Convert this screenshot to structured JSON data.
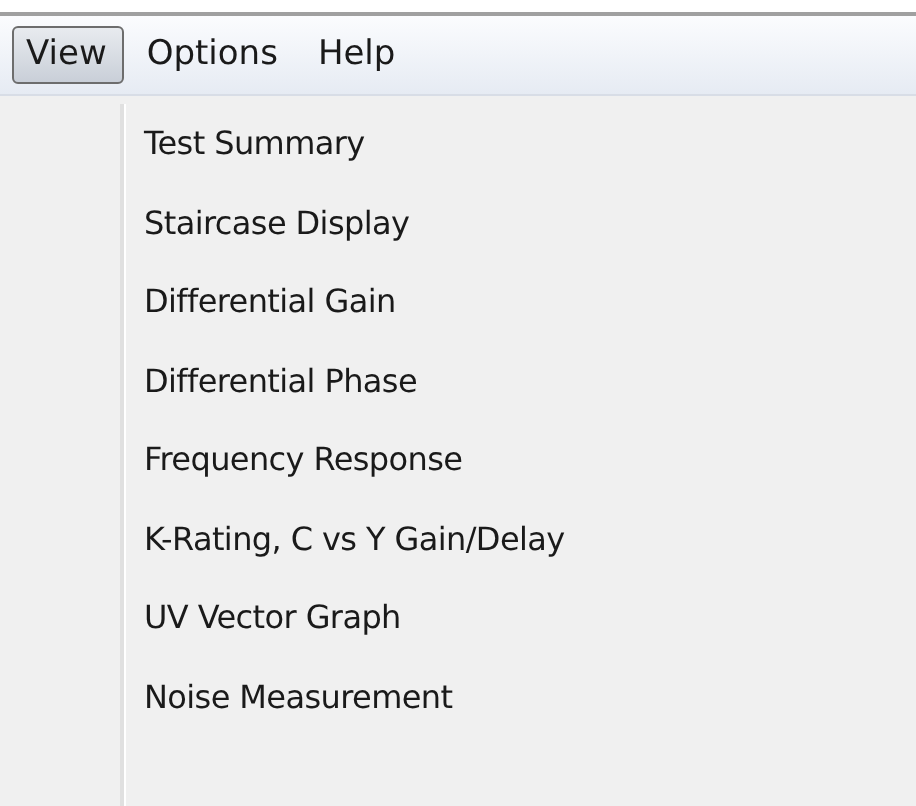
{
  "menubar": [
    {
      "label": "View",
      "selected": true
    },
    {
      "label": "Options",
      "selected": false
    },
    {
      "label": "Help",
      "selected": false
    }
  ],
  "menu": {
    "items": [
      "Test Summary",
      "Staircase Display",
      "Differential Gain",
      "Differential Phase",
      "Frequency Response",
      "K-Rating, C vs Y Gain/Delay",
      "UV Vector Graph",
      "Noise Measurement"
    ]
  }
}
